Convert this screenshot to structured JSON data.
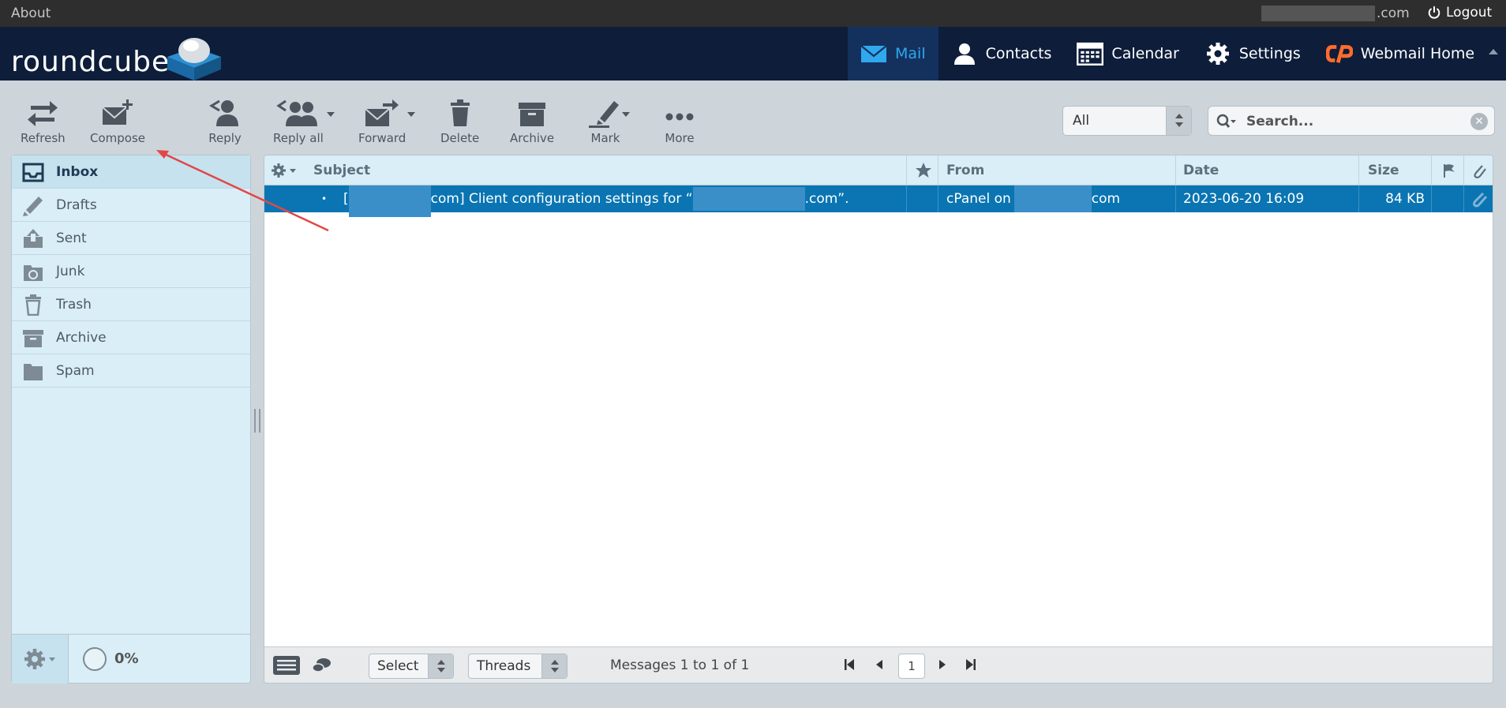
{
  "topline": {
    "about": "About",
    "user_domain": ".com",
    "logout": "Logout"
  },
  "brand": {
    "logo_text": "roundcube"
  },
  "nav": {
    "mail": "Mail",
    "contacts": "Contacts",
    "calendar": "Calendar",
    "settings": "Settings",
    "webmail_home": "Webmail Home"
  },
  "toolbar": {
    "refresh": "Refresh",
    "compose": "Compose",
    "reply": "Reply",
    "reply_all": "Reply all",
    "forward": "Forward",
    "delete": "Delete",
    "archive": "Archive",
    "mark": "Mark",
    "more": "More"
  },
  "filter": {
    "selected": "All"
  },
  "search": {
    "placeholder": "Search..."
  },
  "folders": [
    {
      "label": "Inbox",
      "icon": "inbox-icon",
      "active": true
    },
    {
      "label": "Drafts",
      "icon": "pencil-icon"
    },
    {
      "label": "Sent",
      "icon": "sent-icon"
    },
    {
      "label": "Junk",
      "icon": "junk-icon"
    },
    {
      "label": "Trash",
      "icon": "trash-icon"
    },
    {
      "label": "Archive",
      "icon": "archive-icon"
    },
    {
      "label": "Spam",
      "icon": "folder-icon"
    }
  ],
  "quota": "0%",
  "message_list": {
    "columns": {
      "subject": "Subject",
      "from": "From",
      "date": "Date",
      "size": "Size"
    },
    "rows": [
      {
        "subject_prefix": "[",
        "subject_mid": "com] Client configuration settings for “",
        "subject_end": ".com”.",
        "from_prefix": "cPanel on ",
        "from_suffix": "com",
        "date": "2023-06-20 16:09",
        "size": "84 KB"
      }
    ]
  },
  "list_footer": {
    "select": "Select",
    "threads": "Threads",
    "page_info": "Messages 1 to 1 of 1",
    "page_number": "1"
  },
  "colors": {
    "header_bg": "#0d1d3a",
    "accent": "#2fa8ee",
    "selected_row": "#0a75b2",
    "folder_bg": "#d9eef7"
  }
}
